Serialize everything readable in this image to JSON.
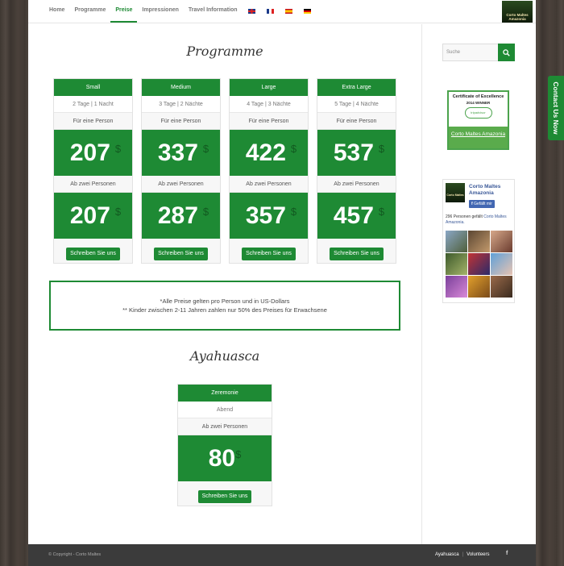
{
  "nav": {
    "items": [
      "Home",
      "Programme",
      "Preise",
      "Impressionen",
      "Travel Information"
    ],
    "active": "Preise",
    "flags": [
      "uk-flag-icon",
      "fr-flag-icon",
      "es-flag-icon",
      "de-flag-icon"
    ]
  },
  "logo": {
    "text": "Corto Maltes Amazonia"
  },
  "programme": {
    "title": "Programme",
    "plans": [
      {
        "name": "Small",
        "duration": "2 Tage | 1 Nacht",
        "single_label": "Für eine Person",
        "single_price": "207",
        "double_label": "Ab zwei Personen",
        "double_price": "207",
        "button": "Schreiben Sie uns"
      },
      {
        "name": "Medium",
        "duration": "3 Tage | 2 Nächte",
        "single_label": "Für eine Person",
        "single_price": "337",
        "double_label": "Ab zwei Personen",
        "double_price": "287",
        "button": "Schreiben Sie uns"
      },
      {
        "name": "Large",
        "duration": "4 Tage | 3 Nächte",
        "single_label": "Für eine Person",
        "single_price": "422",
        "double_label": "Ab zwei Personen",
        "double_price": "357",
        "button": "Schreiben Sie uns"
      },
      {
        "name": "Extra Large",
        "duration": "5 Tage | 4 Nächte",
        "single_label": "Für eine Person",
        "single_price": "537",
        "double_label": "Ab zwei Personen",
        "double_price": "457",
        "button": "Schreiben Sie uns"
      }
    ],
    "currency": "$"
  },
  "notice": {
    "line1": "*Alle Preise gelten pro Person und in US-Dollars",
    "line2": "** Kinder zwischen 2-11 Jahren zahlen nur 50% des Preises für Erwachsene"
  },
  "ayahuasca": {
    "title": "Ayahuasca",
    "name": "Zeremonie",
    "time": "Abend",
    "label": "Ab zwei Personen",
    "price": "80",
    "currency": "$",
    "button": "Schreiben Sie uns"
  },
  "sidebar": {
    "search_placeholder": "Suche",
    "tripadvisor": {
      "title": "Certificate of Excellence",
      "year": "2014 WINNER",
      "brand": "tripadvisor",
      "name": "Corto Maltes Amazonia"
    },
    "facebook": {
      "page_name": "Corto Maltes Amazonia",
      "like_label": "Gefällt mir",
      "count_text": "296 Personen gefällt",
      "count_link": "Corto Maltes Amazonia.",
      "logo_text": "Corto Maltes"
    }
  },
  "contact_tab": "Contact Us Now",
  "footer": {
    "copyright": "© Copyright - Corto Maltes",
    "links": [
      "Ayahuasca",
      "Volunteers"
    ],
    "fb": "f"
  },
  "colors": {
    "accent": "#1e8a34",
    "footer": "#3b3b3b"
  }
}
